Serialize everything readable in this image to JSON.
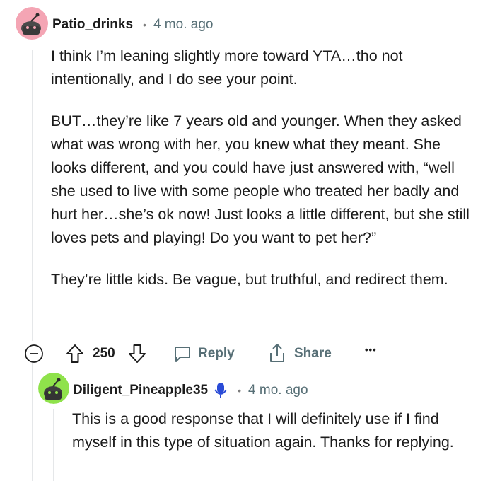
{
  "comment": {
    "author": "Patio_drinks",
    "separator": "•",
    "time": "4 mo. ago",
    "paragraphs": [
      "I think I’m leaning slightly more toward YTA…tho not intentionally, and I do see your point.",
      "BUT…they’re like 7 years old and younger. When they asked what was wrong with her, you knew what they meant. She looks different, and you could have just answered with, “well she used to live with some people who treated her badly and hurt her…she’s ok now! Just looks a little different, but she still loves pets and playing! Do you want to pet her?”",
      "They’re little kids. Be vague, but truthful, and redirect them."
    ],
    "avatar_color": "#f4a5b4"
  },
  "actions": {
    "votes": "250",
    "reply_label": "Reply",
    "share_label": "Share",
    "more_label": "•••"
  },
  "reply": {
    "author": "Diligent_Pineapple35",
    "separator": "•",
    "time": "4 mo. ago",
    "text": "This is a good response that I will definitely use if I find myself in this type of situation again. Thanks for replying.",
    "avatar_color": "#8fe24b",
    "badge_color": "#2a4bd7"
  }
}
